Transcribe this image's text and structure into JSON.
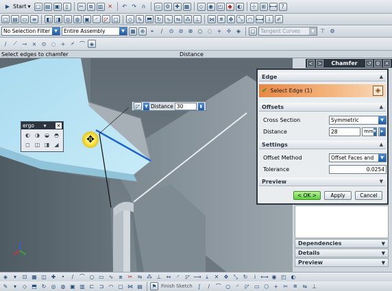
{
  "toolbar1": {
    "start_label": "Start",
    "icons": [
      "new-icon",
      "open-icon",
      "save-icon",
      "page-icon",
      "scissors-icon",
      "copy-icon",
      "paste-icon",
      "delete-icon",
      "undo-icon",
      "redo-icon",
      "magnet-icon",
      "window-icon",
      "tools-icon",
      "snap-icon",
      "grid-icon",
      "analysis-icon",
      "render-icon",
      "view-icon",
      "layer-icon",
      "shading-icon",
      "wcs-icon",
      "fit-icon",
      "measure-icon",
      "help-icon"
    ]
  },
  "toolbar2": {
    "icons": [
      "select-icon",
      "tab-icon",
      "window-icon",
      "menu-icon",
      "cube-icon",
      "feature-icon",
      "hole-icon",
      "boss-icon",
      "pocket-icon",
      "edge-blend-icon",
      "chamfer-icon",
      "shell-icon",
      "datum-icon",
      "sketch-icon",
      "extrude-icon",
      "revolve-icon",
      "sweep-icon",
      "mirror-icon",
      "pattern-icon",
      "trim-icon",
      "sew-icon",
      "offset-icon",
      "move-icon",
      "scale-icon",
      "blend-icon",
      "measure-icon",
      "info-icon",
      "layer-icon",
      "color-icon",
      "note-icon"
    ]
  },
  "toolbar3": {
    "selection_filter": "No Selection Filter",
    "assembly_scope": "Entire Assembly",
    "tangent_curves": "Tangent Curves",
    "icons": [
      "select-all-icon",
      "deselect-icon",
      "filter-icon",
      "snap-point-icon",
      "endpoint-icon",
      "midpoint-icon",
      "control-point-icon",
      "intersection-icon",
      "arc-center-icon",
      "quadrant-icon",
      "existing-point-icon",
      "point-on-curve-icon",
      "cube-icon"
    ]
  },
  "cue_line": {
    "prompt": "Select edges to chamfer",
    "status": "Distance"
  },
  "float_distance": {
    "label": "Distance",
    "value": "30"
  },
  "ergo": {
    "title": "ergo"
  },
  "nav_panel": {
    "title": "Chamfer",
    "sections": [
      {
        "label": "Dependencies"
      },
      {
        "label": "Details"
      },
      {
        "label": "Preview"
      }
    ]
  },
  "dialog": {
    "edge_section": "Edge",
    "select_edge": "Select Edge (1)",
    "offsets_section": "Offsets",
    "cross_section_label": "Cross Section",
    "cross_section_value": "Symmetric",
    "distance_label": "Distance",
    "distance_value": "28",
    "distance_unit": "mm",
    "settings_section": "Settings",
    "offset_method_label": "Offset Method",
    "offset_method_value": "Offset Faces and",
    "tolerance_label": "Tolerance",
    "tolerance_value": "0.0254",
    "preview_section": "Preview",
    "ok_label": "< OK >",
    "apply_label": "Apply",
    "cancel_label": "Cancel"
  },
  "bottom_bar": {
    "finish_sketch": "Finish Sketch"
  }
}
